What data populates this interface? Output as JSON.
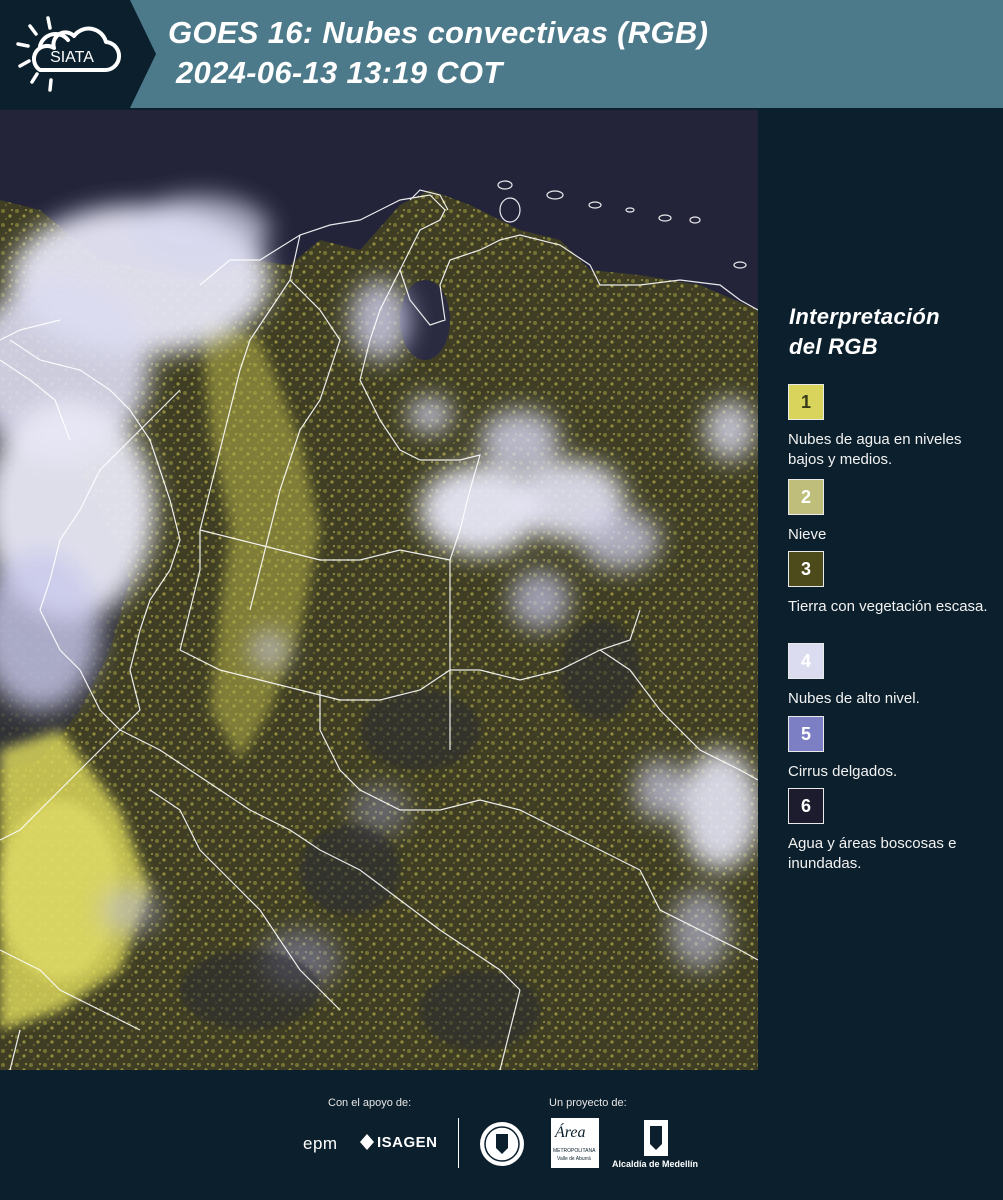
{
  "header": {
    "logo_text": "SIATA",
    "title": "GOES 16: Nubes convectivas (RGB)",
    "subtitle": "2024-06-13 13:19 COT"
  },
  "legend": {
    "heading_line1": "Interpretación",
    "heading_line2": "del RGB",
    "items": [
      {
        "number": "1",
        "label": "Nubes de agua en niveles bajos y medios.",
        "color": "#d9d55c",
        "text_color": "#3a3a1a"
      },
      {
        "number": "2",
        "label": "Nieve",
        "color": "#bfbe7a",
        "text_color": "#ffffff"
      },
      {
        "number": "3",
        "label": "Tierra con vegetación escasa.",
        "color": "#4d4a1c",
        "text_color": "#ffffff"
      },
      {
        "number": "4",
        "label": "Nubes de alto nivel.",
        "color": "#dcdcf0",
        "text_color": "#ffffff"
      },
      {
        "number": "5",
        "label": "Cirrus delgados.",
        "color": "#7d7fc4",
        "text_color": "#ffffff"
      },
      {
        "number": "6",
        "label": "Agua y áreas boscosas e inundadas.",
        "color": "#1c1c2e",
        "text_color": "#ffffff"
      }
    ]
  },
  "footer": {
    "support_caption": "Con el apoyo de:",
    "project_caption": "Un proyecto de:",
    "brand_epm": "epm",
    "brand_isagen": "ISAGEN",
    "area_metro_name": "Área",
    "area_metro_sub": "METROPOLITANA",
    "area_metro_sub2": "Valle de Aburrá",
    "alcaldia": "Alcaldía de Medellín"
  },
  "colors": {
    "background": "#0b1f2c",
    "header": "#4c7a8a",
    "cloud_high": "#e8e8f6",
    "cloud_low": "#d9d55c",
    "water": "#1c1c2e",
    "land": "#4d4a1c"
  }
}
